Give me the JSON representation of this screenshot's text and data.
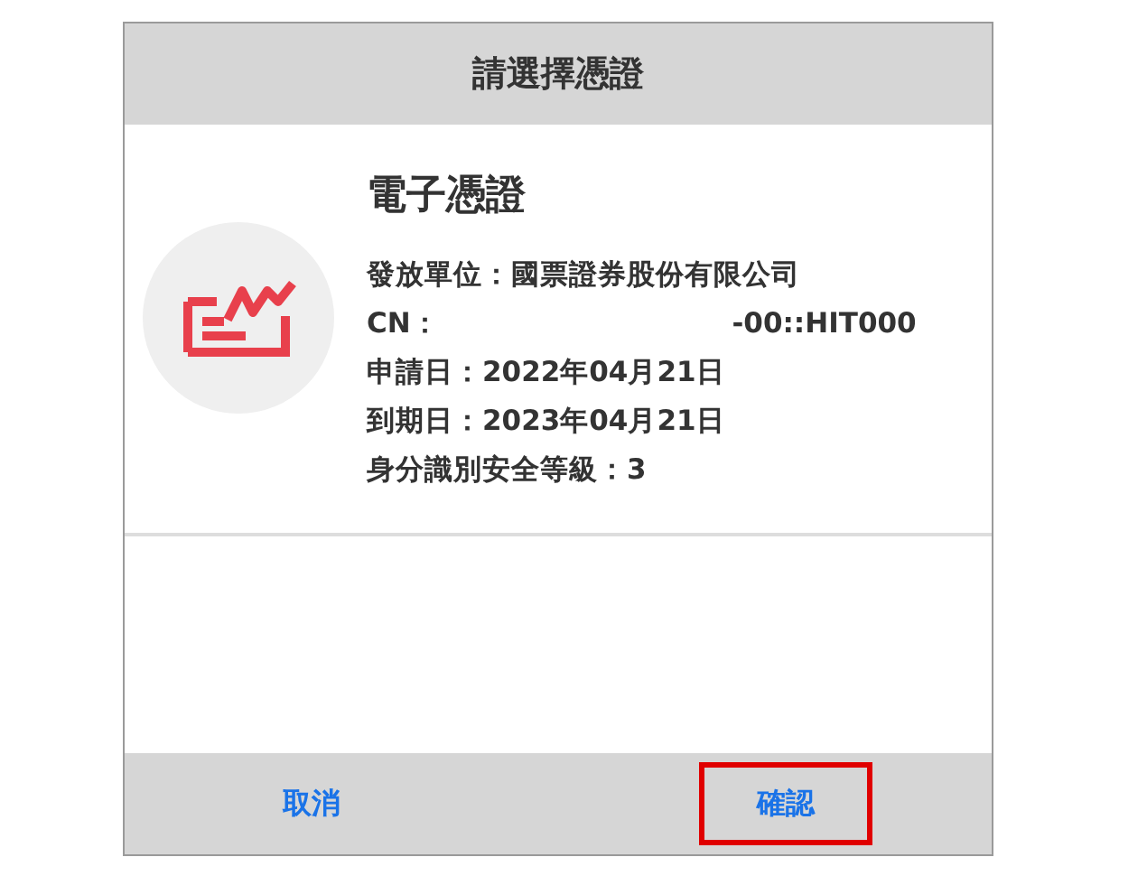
{
  "dialog": {
    "title": "請選擇憑證",
    "certificate": {
      "name": "電子憑證",
      "details": [
        "發放單位：國票證券股份有限公司",
        "CN：                              -00::HIT000",
        "申請日：2022年04月21日",
        "到期日：2023年04月21日",
        "身分識別安全等級：3"
      ]
    },
    "buttons": [
      {
        "label": "取消",
        "highlighted": false
      },
      {
        "label": "確認",
        "highlighted": true
      }
    ]
  }
}
